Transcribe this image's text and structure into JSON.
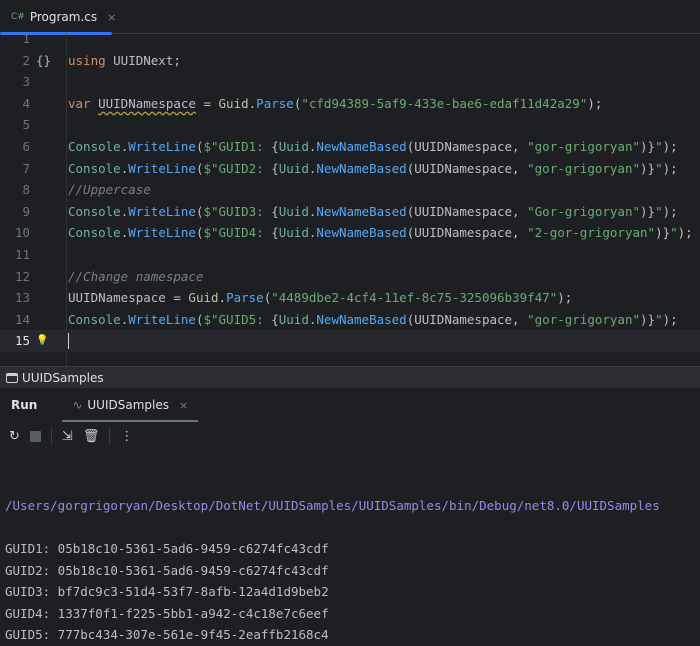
{
  "tab": {
    "lang": "C#",
    "title": "Program.cs",
    "close": "×"
  },
  "editor": {
    "current_line": 15,
    "lines": [
      [],
      [
        [
          "k",
          "using "
        ],
        [
          "v",
          "UUIDNext;"
        ]
      ],
      [],
      [
        [
          "k",
          "var "
        ],
        [
          "u",
          "UUIDNamespace"
        ],
        [
          "v",
          " = "
        ],
        [
          "c",
          "Guid"
        ],
        [
          "v",
          "."
        ],
        [
          "m",
          "Parse"
        ],
        [
          "v",
          "("
        ],
        [
          "s",
          "\"cfd94389-5af9-433e-bae6-edaf11d42a29\""
        ],
        [
          "v",
          ");"
        ]
      ],
      [],
      [
        [
          "cls",
          "Console"
        ],
        [
          "v",
          "."
        ],
        [
          "m",
          "WriteLine"
        ],
        [
          "v",
          "("
        ],
        [
          "s",
          "$\"GUID1: "
        ],
        [
          "v",
          "{"
        ],
        [
          "cls",
          "Uuid"
        ],
        [
          "v",
          "."
        ],
        [
          "m",
          "NewNameBased"
        ],
        [
          "v",
          "(UUIDNamespace, "
        ],
        [
          "s",
          "\"gor-grigoryan\""
        ],
        [
          "v",
          ")}"
        ],
        [
          "s",
          "\""
        ],
        [
          "v",
          ");"
        ]
      ],
      [
        [
          "cls",
          "Console"
        ],
        [
          "v",
          "."
        ],
        [
          "m",
          "WriteLine"
        ],
        [
          "v",
          "("
        ],
        [
          "s",
          "$\"GUID2: "
        ],
        [
          "v",
          "{"
        ],
        [
          "cls",
          "Uuid"
        ],
        [
          "v",
          "."
        ],
        [
          "m",
          "NewNameBased"
        ],
        [
          "v",
          "(UUIDNamespace, "
        ],
        [
          "s",
          "\"gor-grigoryan\""
        ],
        [
          "v",
          ")}"
        ],
        [
          "s",
          "\""
        ],
        [
          "v",
          ");"
        ]
      ],
      [
        [
          "cm",
          "//Uppercase"
        ]
      ],
      [
        [
          "cls",
          "Console"
        ],
        [
          "v",
          "."
        ],
        [
          "m",
          "WriteLine"
        ],
        [
          "v",
          "("
        ],
        [
          "s",
          "$\"GUID3: "
        ],
        [
          "v",
          "{"
        ],
        [
          "cls",
          "Uuid"
        ],
        [
          "v",
          "."
        ],
        [
          "m",
          "NewNameBased"
        ],
        [
          "v",
          "(UUIDNamespace, "
        ],
        [
          "s",
          "\"Gor-grigoryan\""
        ],
        [
          "v",
          ")}"
        ],
        [
          "s",
          "\""
        ],
        [
          "v",
          ");"
        ]
      ],
      [
        [
          "cls",
          "Console"
        ],
        [
          "v",
          "."
        ],
        [
          "m",
          "WriteLine"
        ],
        [
          "v",
          "("
        ],
        [
          "s",
          "$\"GUID4: "
        ],
        [
          "v",
          "{"
        ],
        [
          "cls",
          "Uuid"
        ],
        [
          "v",
          "."
        ],
        [
          "m",
          "NewNameBased"
        ],
        [
          "v",
          "(UUIDNamespace, "
        ],
        [
          "s",
          "\"2-gor-grigoryan\""
        ],
        [
          "v",
          ")}"
        ],
        [
          "s",
          "\""
        ],
        [
          "v",
          ");"
        ]
      ],
      [],
      [
        [
          "cm",
          "//Change namespace"
        ]
      ],
      [
        [
          "v",
          "UUIDNamespace = "
        ],
        [
          "c",
          "Guid"
        ],
        [
          "v",
          "."
        ],
        [
          "m",
          "Parse"
        ],
        [
          "v",
          "("
        ],
        [
          "s",
          "\"4489dbe2-4cf4-11ef-8c75-325096b39f47\""
        ],
        [
          "v",
          ");"
        ]
      ],
      [
        [
          "cls",
          "Console"
        ],
        [
          "v",
          "."
        ],
        [
          "m",
          "WriteLine"
        ],
        [
          "v",
          "("
        ],
        [
          "s",
          "$\"GUID5: "
        ],
        [
          "v",
          "{"
        ],
        [
          "cls",
          "Uuid"
        ],
        [
          "v",
          "."
        ],
        [
          "m",
          "NewNameBased"
        ],
        [
          "v",
          "(UUIDNamespace, "
        ],
        [
          "s",
          "\"gor-grigoryan\""
        ],
        [
          "v",
          ")}"
        ],
        [
          "s",
          "\""
        ],
        [
          "v",
          ");"
        ]
      ],
      []
    ]
  },
  "panel": {
    "title": "UUIDSamples",
    "run_label": "Run",
    "run_tab": "UUIDSamples",
    "close": "×"
  },
  "output": {
    "path": "/Users/gorgrigoryan/Desktop/DotNet/UUIDSamples/UUIDSamples/bin/Debug/net8.0/UUIDSamples",
    "lines": [
      "GUID1: 05b18c10-5361-5ad6-9459-c6274fc43cdf",
      "GUID2: 05b18c10-5361-5ad6-9459-c6274fc43cdf",
      "GUID3: bf7dc9c3-51d4-53f7-8afb-12a4d1d9beb2",
      "GUID4: 1337f0f1-f225-5bb1-a942-c4c18e7c6eef",
      "GUID5: 777bc434-307e-561e-9f45-2eaffb2168c4"
    ]
  }
}
